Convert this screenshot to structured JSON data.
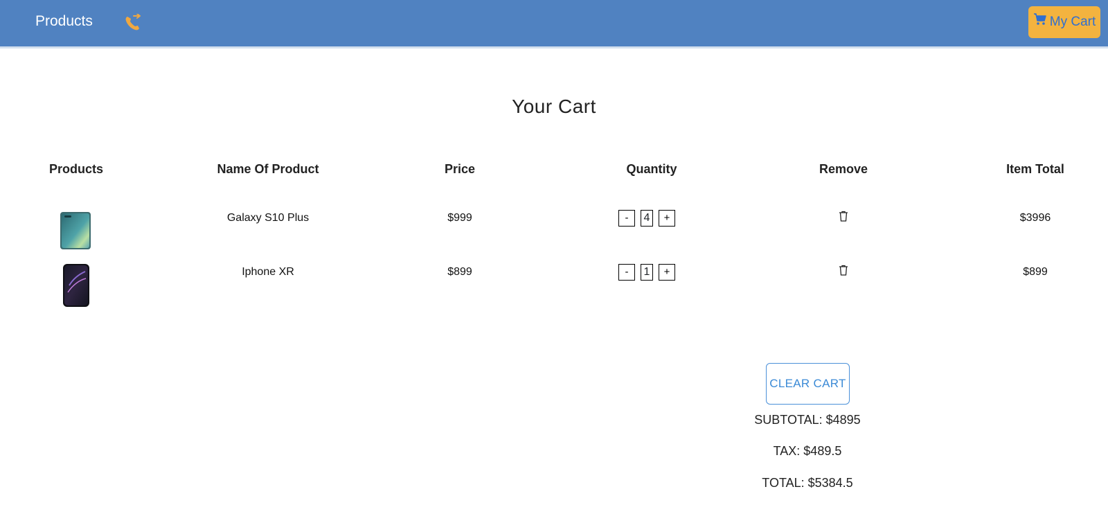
{
  "nav": {
    "brand": "Products",
    "cart_label": "My Cart"
  },
  "page_title": "Your Cart",
  "columns": [
    "Products",
    "Name Of Product",
    "Price",
    "Quantity",
    "Remove",
    "Item Total"
  ],
  "items": [
    {
      "name": "Galaxy S10 Plus",
      "price": "$999",
      "quantity": "4",
      "total": "$3996"
    },
    {
      "name": "Iphone XR",
      "price": "$899",
      "quantity": "1",
      "total": "$899"
    }
  ],
  "qty_controls": {
    "decrement": "-",
    "increment": "+"
  },
  "summary": {
    "clear_label": "CLEAR CART",
    "subtotal": "SUBTOTAL: $4895",
    "tax": "TAX: $489.5",
    "total": "TOTAL: $5384.5"
  },
  "colors": {
    "navbar": "#5082c1",
    "cart_button": "#f3b33f",
    "accent": "#3b8ad6"
  }
}
